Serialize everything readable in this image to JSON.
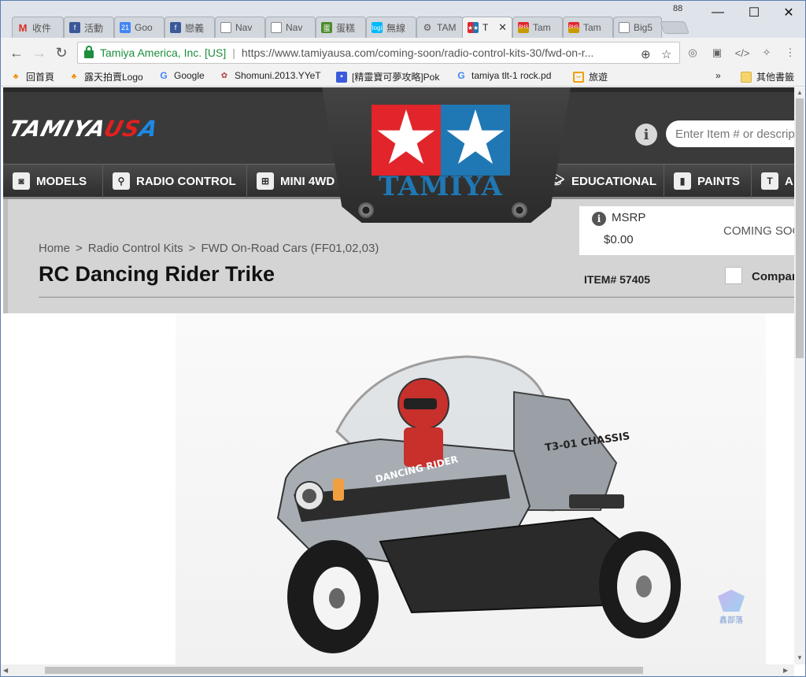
{
  "browser": {
    "tab_count": "88",
    "tabs": [
      {
        "label": "收件",
        "icon": "gmail-icon"
      },
      {
        "label": "活動",
        "icon": "facebook-icon"
      },
      {
        "label": "Goo",
        "icon": "calendar-icon"
      },
      {
        "label": "戀義",
        "icon": "facebook-icon"
      },
      {
        "label": "Nav",
        "icon": "page-icon"
      },
      {
        "label": "Nav",
        "icon": "page-icon"
      },
      {
        "label": "蛋糕",
        "icon": "green-badge-icon"
      },
      {
        "label": "無線",
        "icon": "logi-icon"
      },
      {
        "label": "TAM",
        "icon": "car-icon"
      },
      {
        "label": "T",
        "icon": "tamiya-icon"
      },
      {
        "label": "Tam",
        "icon": "bhs-icon"
      },
      {
        "label": "Tam",
        "icon": "bhs-icon"
      },
      {
        "label": "Big5",
        "icon": "page-icon"
      }
    ],
    "active_tab_index": 9,
    "window_controls": {
      "minimize": "—",
      "maximize": "☐",
      "close": "✕"
    },
    "omnibox": {
      "site_identity": "Tamiya America, Inc. [US]",
      "url": "https://www.tamiyausa.com/coming-soon/radio-control-kits-30/fwd-on-r..."
    },
    "bookmarks": [
      {
        "label": "回首頁",
        "icon": "ruten-icon"
      },
      {
        "label": "露天拍賣Logo",
        "icon": "ruten-icon"
      },
      {
        "label": "Google",
        "icon": "google-icon"
      },
      {
        "label": "Shomuni.2013.YYeT",
        "icon": "shomuni-icon"
      },
      {
        "label": "[精靈寶可夢攻略]Pok",
        "icon": "blue-speech-icon"
      },
      {
        "label": "tamiya tlt-1 rock.pd",
        "icon": "google-icon"
      },
      {
        "label": "旅遊",
        "icon": "orange-box-icon"
      }
    ],
    "bookmarks_overflow": "»",
    "other_bookmarks": "其他書籤"
  },
  "site": {
    "logo_main": "TAMIYA",
    "logo_usa": "US",
    "logo_a": "A",
    "emblem_word": "TAMIYA",
    "search_placeholder": "Enter Item # or descrip",
    "nav": [
      {
        "label": "MODELS",
        "icon": "models-icon"
      },
      {
        "label": "RADIO CONTROL",
        "icon": "rc-icon"
      },
      {
        "label": "MINI 4WD",
        "icon": "mini4wd-icon"
      },
      {
        "label": "EDUCATIONAL",
        "icon": "graduation-icon"
      },
      {
        "label": "PAINTS",
        "icon": "paint-icon"
      },
      {
        "label": "A",
        "icon": "tshirt-icon"
      }
    ]
  },
  "product": {
    "breadcrumb": [
      "Home",
      "Radio Control Kits",
      "FWD On-Road Cars (FF01,02,03)"
    ],
    "breadcrumb_sep": ">",
    "title": "RC Dancing Rider Trike",
    "msrp_label": "MSRP",
    "msrp_value": "$0.00",
    "status": "COMING SOON",
    "item_number": "ITEM# 57405",
    "compare_label": "Compare",
    "photo_alt_texts": {
      "body_label": "DANCING RIDER",
      "chassis_label": "T3-01 CHASSIS"
    },
    "watermark": "鑫部落"
  }
}
